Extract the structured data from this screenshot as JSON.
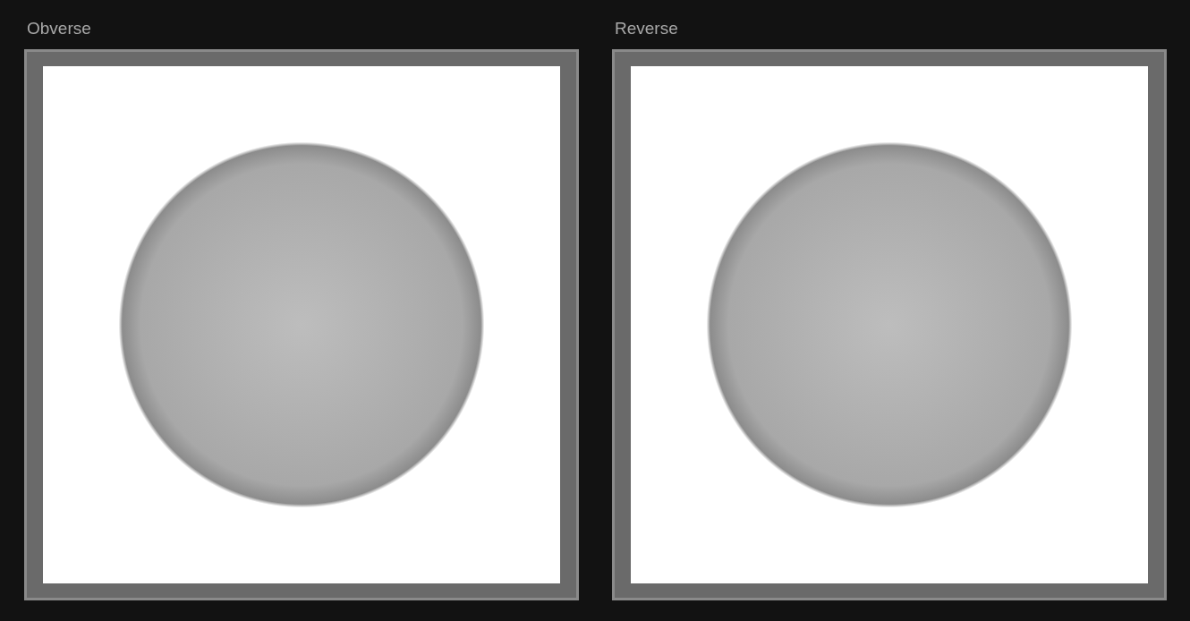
{
  "panels": [
    {
      "label": "Obverse"
    },
    {
      "label": "Reverse"
    }
  ]
}
